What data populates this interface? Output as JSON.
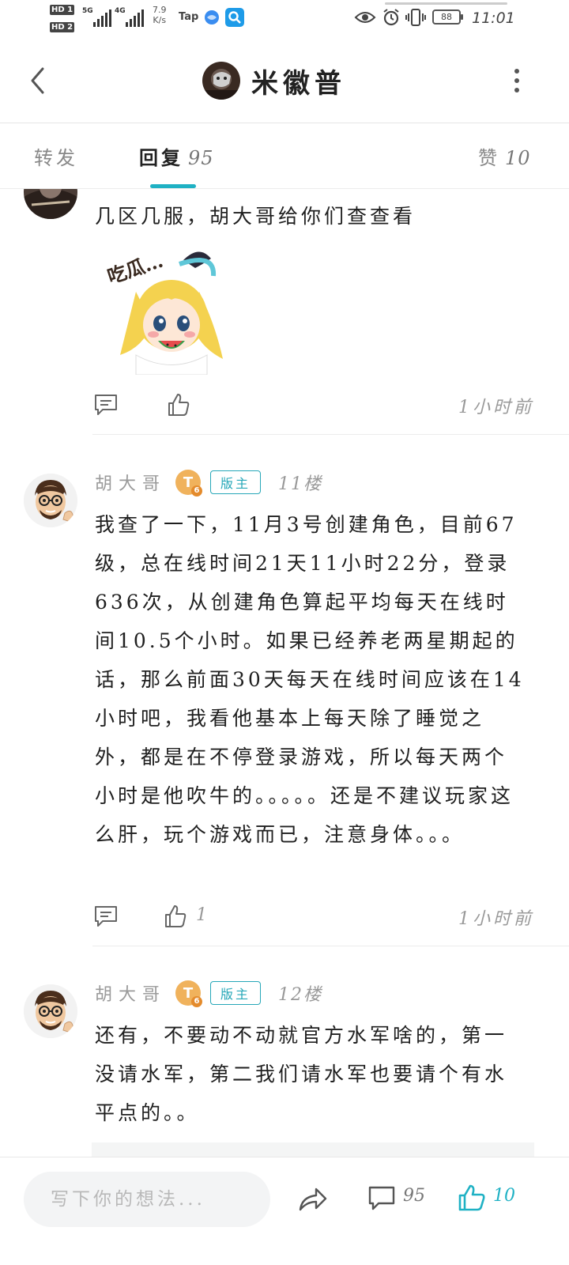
{
  "status_bar": {
    "hd1": "HD 1",
    "hd2": "HD 2",
    "net1": "5G",
    "net2": "4G",
    "speed_value": "7.9",
    "speed_unit": "K/s",
    "app_tap": "Tap",
    "battery": "88",
    "time": "11:01"
  },
  "header": {
    "title": "米徽普"
  },
  "tabs": [
    {
      "label": "转发",
      "count": ""
    },
    {
      "label": "回复",
      "count": "95"
    },
    {
      "label": "赞",
      "count": "10"
    }
  ],
  "replies": [
    {
      "text": "几区几服，胡大哥给你们查查看",
      "sticker_text": "吃瓜…",
      "time": "1小时前",
      "like_count": ""
    },
    {
      "author": "胡大哥",
      "level_badge": "T",
      "level_num": "6",
      "role": "版主",
      "floor": "11楼",
      "text": "我查了一下，11月3号创建角色，目前67级，总在线时间21天11小时22分，登录636次，从创建角色算起平均每天在线时间10.5个小时。如果已经养老两星期起的话，那么前面30天每天在线时间应该在14小时吧，我看他基本上每天除了睡觉之外，都是在不停登录游戏，所以每天两个小时是他吹牛的。。。。。还是不建议玩家这么肝，玩个游戏而已，注意身体。。。",
      "like_count": "1",
      "time": "1小时前"
    },
    {
      "author": "胡大哥",
      "level_badge": "T",
      "level_num": "6",
      "role": "版主",
      "floor": "12楼",
      "text": "还有，不要动不动就官方水军啥的，第一没请水军，第二我们请水军也要请个有水平点的。。"
    }
  ],
  "bottom_bar": {
    "input_placeholder": "写下你的想法...",
    "comment_count": "95",
    "like_count": "10"
  },
  "colors": {
    "accent": "#1fb1c4",
    "badge_gold": "#f0b25c",
    "text_muted": "#999999"
  }
}
